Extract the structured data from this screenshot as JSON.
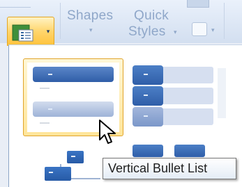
{
  "ribbon": {
    "shapes_label": "Shapes",
    "quick_styles_line1": "Quick",
    "quick_styles_line2": "Styles",
    "dropdown_glyph": "▾",
    "smartart_button_icon": "smartart-layout-icon",
    "accent_color": "#ffc23a"
  },
  "gallery": {
    "items": [
      {
        "icon": "vertical-bullet-list-thumbnail",
        "selected": true
      },
      {
        "icon": "stacked-list-thumbnail",
        "selected": false
      },
      {
        "icon": "hierarchy-thumbnail",
        "selected": false
      },
      {
        "icon": "block-list-thumbnail",
        "selected": false
      }
    ]
  },
  "tooltip": {
    "text": "Vertical Bullet List"
  },
  "cursor": {
    "icon": "arrow-pointer-icon"
  }
}
